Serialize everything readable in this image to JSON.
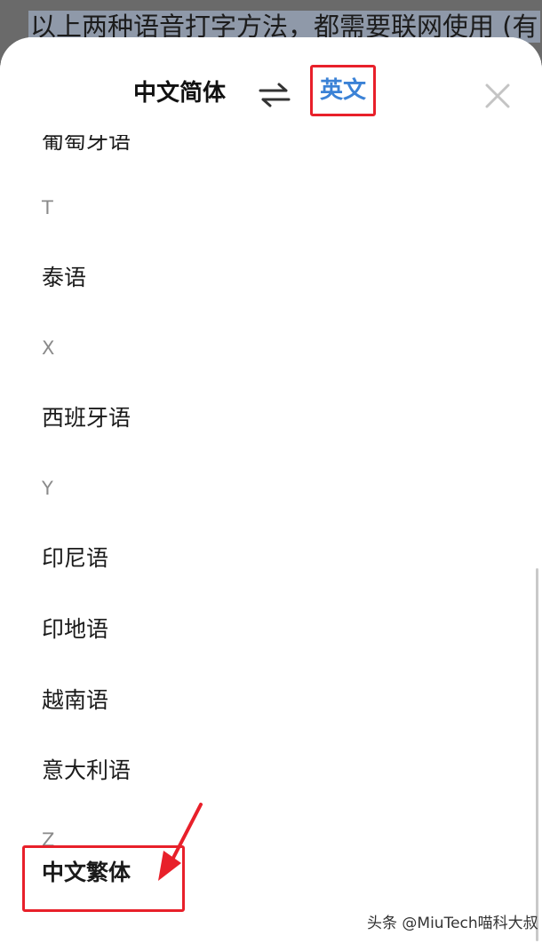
{
  "background": {
    "text": "以上两种语音打字方法，都需要联网使用 (有"
  },
  "header": {
    "source_language": "中文简体",
    "target_language": "英文",
    "swap_icon": "swap-arrows-icon",
    "close_icon": "close-icon"
  },
  "language_list": {
    "partial_top_item": "葡萄牙语",
    "sections": [
      {
        "letter": "T",
        "items": [
          "泰语"
        ]
      },
      {
        "letter": "X",
        "items": [
          "西班牙语"
        ]
      },
      {
        "letter": "Y",
        "items": [
          "印尼语",
          "印地语",
          "越南语",
          "意大利语"
        ]
      },
      {
        "letter": "Z",
        "items": [
          "中文繁体"
        ]
      }
    ]
  },
  "annotation": {
    "highlighted_item": "中文繁体",
    "highlight_color": "#e8202a"
  },
  "colors": {
    "accent": "#3b82d6",
    "annotation_red": "#e8202a"
  },
  "watermark": "头条 @MiuTech喵科大叔"
}
